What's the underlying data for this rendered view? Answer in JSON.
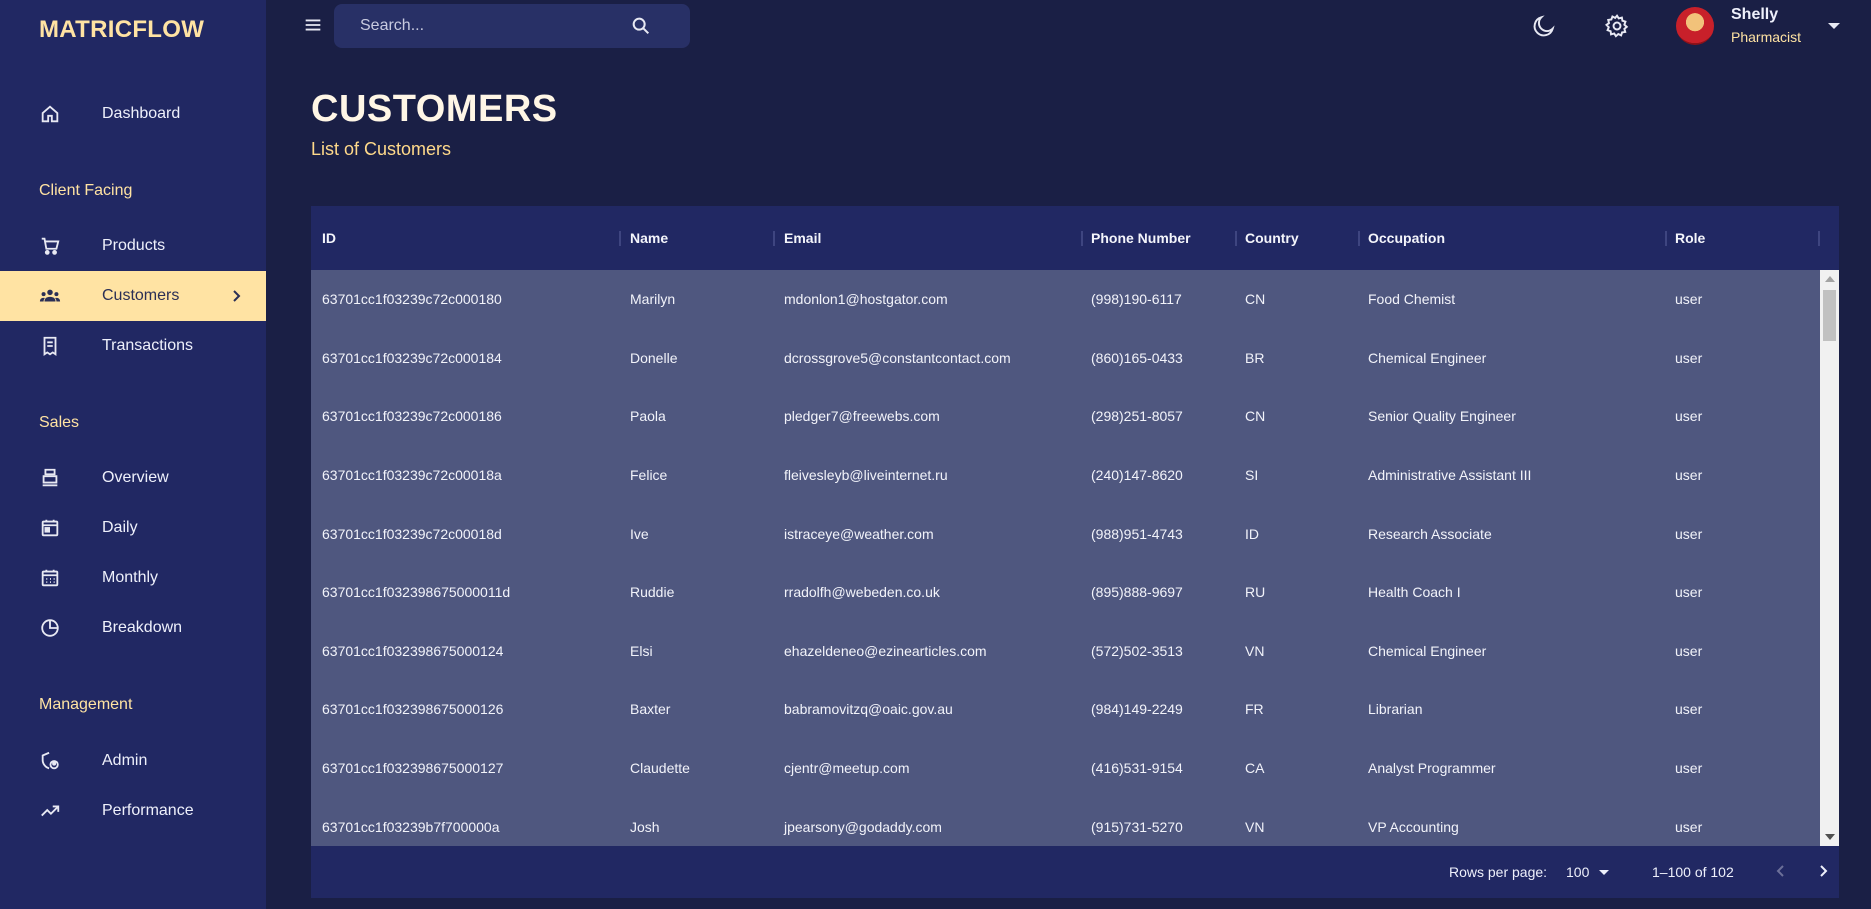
{
  "brand": "MATRICFLOW",
  "nav": {
    "dashboard": "Dashboard",
    "client_facing": "Client Facing",
    "products": "Products",
    "customers": "Customers",
    "transactions": "Transactions",
    "sales": "Sales",
    "overview": "Overview",
    "daily": "Daily",
    "monthly": "Monthly",
    "breakdown": "Breakdown",
    "management": "Management",
    "admin": "Admin",
    "performance": "Performance"
  },
  "search": {
    "placeholder": "Search..."
  },
  "user": {
    "name": "Shelly",
    "role": "Pharmacist"
  },
  "header": {
    "title": "CUSTOMERS",
    "subtitle": "List of Customers"
  },
  "table": {
    "columns": [
      "ID",
      "Name",
      "Email",
      "Phone Number",
      "Country",
      "Occupation",
      "Role"
    ],
    "rows": [
      [
        "63701cc1f03239c72c000180",
        "Marilyn",
        "mdonlon1@hostgator.com",
        "(998)190-6117",
        "CN",
        "Food Chemist",
        "user"
      ],
      [
        "63701cc1f03239c72c000184",
        "Donelle",
        "dcrossgrove5@constantcontact.com",
        "(860)165-0433",
        "BR",
        "Chemical Engineer",
        "user"
      ],
      [
        "63701cc1f03239c72c000186",
        "Paola",
        "pledger7@freewebs.com",
        "(298)251-8057",
        "CN",
        "Senior Quality Engineer",
        "user"
      ],
      [
        "63701cc1f03239c72c00018a",
        "Felice",
        "fleivesleyb@liveinternet.ru",
        "(240)147-8620",
        "SI",
        "Administrative Assistant III",
        "user"
      ],
      [
        "63701cc1f03239c72c00018d",
        "Ive",
        "istraceye@weather.com",
        "(988)951-4743",
        "ID",
        "Research Associate",
        "user"
      ],
      [
        "63701cc1f032398675000011d",
        "Ruddie",
        "rradolfh@webeden.co.uk",
        "(895)888-9697",
        "RU",
        "Health Coach I",
        "user"
      ],
      [
        "63701cc1f032398675000124",
        "Elsi",
        "ehazeldeneo@ezinearticles.com",
        "(572)502-3513",
        "VN",
        "Chemical Engineer",
        "user"
      ],
      [
        "63701cc1f032398675000126",
        "Baxter",
        "babramovitzq@oaic.gov.au",
        "(984)149-2249",
        "FR",
        "Librarian",
        "user"
      ],
      [
        "63701cc1f032398675000127",
        "Claudette",
        "cjentr@meetup.com",
        "(416)531-9154",
        "CA",
        "Analyst Programmer",
        "user"
      ],
      [
        "63701cc1f03239b7f700000a",
        "Josh",
        "jpearsony@godaddy.com",
        "(915)731-5270",
        "VN",
        "VP Accounting",
        "user"
      ]
    ]
  },
  "footer": {
    "rows_per_page_label": "Rows per page:",
    "rows_per_page_value": "100",
    "range": "1–100 of 102"
  },
  "colors": {
    "accent": "#ffe3a3",
    "background": "#1a1f45",
    "sidebar": "#212863",
    "table_body": "#4f577f"
  }
}
